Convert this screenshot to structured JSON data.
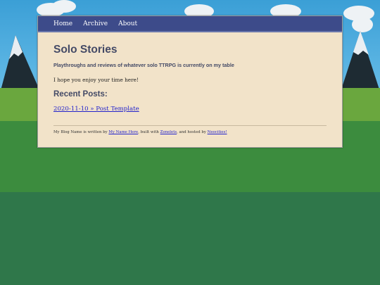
{
  "nav": {
    "items": [
      {
        "label": "Home"
      },
      {
        "label": "Archive"
      },
      {
        "label": "About"
      }
    ]
  },
  "header": {
    "title": "Solo Stories",
    "tagline": "Playthroughs and reviews of whatever solo TTRPG is currently on my table"
  },
  "main": {
    "welcome": "I hope you enjoy your time here!",
    "recent_heading": "Recent Posts:",
    "posts": [
      {
        "label": "2020-11-10 » Post Template"
      }
    ]
  },
  "footer": {
    "part1": "My Blog Name is written by ",
    "author_link": "My Name Here",
    "part2": ", built with ",
    "zonelets_link": "Zonelets",
    "part3": ", and hosted by ",
    "neocities_link": "Neocities!"
  },
  "colors": {
    "navbar": "#3d4b8a",
    "page_background": "#f2e3c9",
    "heading_text": "#444a66",
    "link": "#2222cc",
    "sky": "#3b9fd6",
    "grass_light": "#6aa73e",
    "grass_mid": "#3c8c3e",
    "grass_dark": "#2f774a"
  }
}
